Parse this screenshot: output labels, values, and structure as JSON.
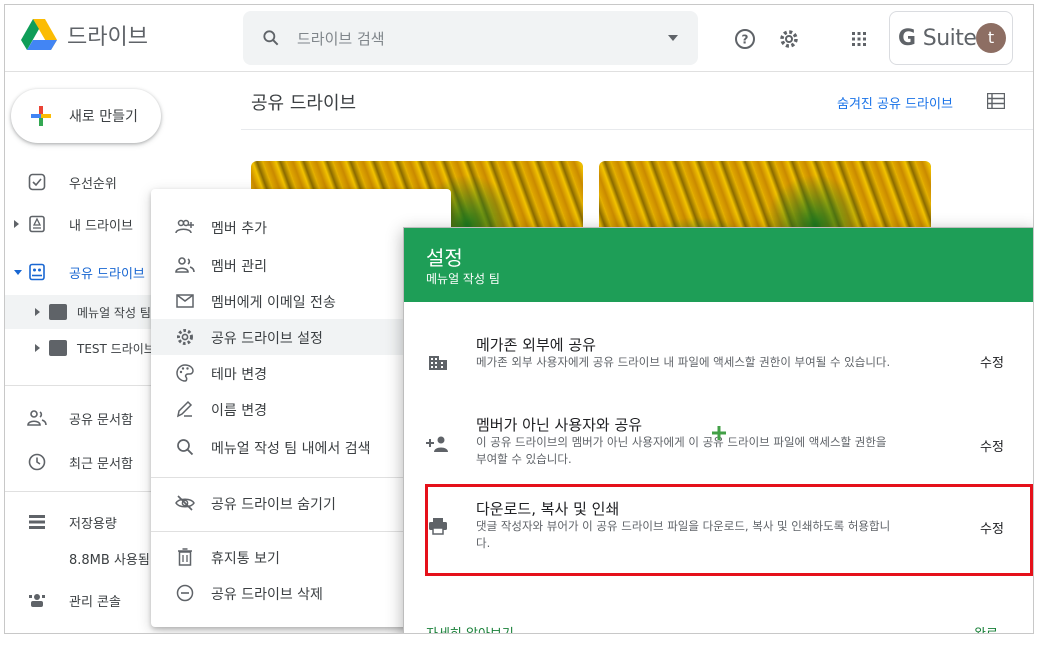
{
  "app": {
    "name": "드라이브",
    "search_placeholder": "드라이브 검색",
    "suite_label_bold": "G",
    "suite_label_light": "Suite",
    "avatar_letter": "t"
  },
  "sidebar": {
    "new_button": "새로 만들기",
    "items": [
      {
        "label": "우선순위",
        "icon": "check-icon"
      },
      {
        "label": "내 드라이브",
        "icon": "drive-icon"
      },
      {
        "label": "공유 드라이브",
        "icon": "shared-drive-icon"
      }
    ],
    "shared_drives": [
      {
        "label": "메뉴얼 작성 팀"
      },
      {
        "label": "TEST 드라이브"
      }
    ],
    "lower_items": [
      {
        "label": "공유 문서함",
        "icon": "people-icon"
      },
      {
        "label": "최근 문서함",
        "icon": "clock-icon"
      }
    ],
    "storage": {
      "label": "저장용량",
      "usage": "8.8MB 사용됨"
    },
    "admin": {
      "label": "관리 콘솔"
    }
  },
  "main": {
    "title": "공유 드라이브",
    "hidden_drives_link": "숨겨진 공유 드라이브"
  },
  "context_menu": {
    "items": [
      {
        "label": "멤버 추가",
        "icon": "add-member-icon"
      },
      {
        "label": "멤버 관리",
        "icon": "manage-members-icon"
      },
      {
        "label": "멤버에게 이메일 전송",
        "icon": "mail-icon"
      },
      {
        "label": "공유 드라이브 설정",
        "icon": "settings-icon"
      },
      {
        "label": "테마 변경",
        "icon": "palette-icon"
      },
      {
        "label": "이름 변경",
        "icon": "rename-icon"
      },
      {
        "label": "메뉴얼 작성 팀 내에서 검색",
        "icon": "search-icon"
      }
    ],
    "hide_item": {
      "label": "공유 드라이브 숨기기",
      "icon": "hide-icon"
    },
    "trash_item": {
      "label": "휴지통 보기",
      "icon": "trash-icon"
    },
    "delete_item": {
      "label": "공유 드라이브 삭제",
      "icon": "remove-icon"
    }
  },
  "settings_dialog": {
    "title": "설정",
    "subtitle": "메뉴얼 작성 팀",
    "rows": [
      {
        "title": "메가존 외부에 공유",
        "desc": "메가존 외부 사용자에게 공유 드라이브 내 파일에 액세스할 권한이 부여될 수 있습니다.",
        "action": "수정"
      },
      {
        "title": "멤버가 아닌 사용자와 공유",
        "desc": "이 공유 드라이브의 멤버가 아닌 사용자에게 이 공유 드라이브 파일에 액세스할 권한을 부여할 수 있습니다.",
        "action": "수정"
      },
      {
        "title": "다운로드, 복사 및 인쇄",
        "desc": "댓글 작성자와 뷰어가 이 공유 드라이브 파일을 다운로드, 복사 및 인쇄하도록 허용합니다.",
        "action": "수정"
      }
    ],
    "learn_more": "자세히 알아보기",
    "done": "완료"
  },
  "colors": {
    "accent_blue": "#1a73e8",
    "header_green": "#1e9e57",
    "highlight_red": "#e5101a"
  }
}
